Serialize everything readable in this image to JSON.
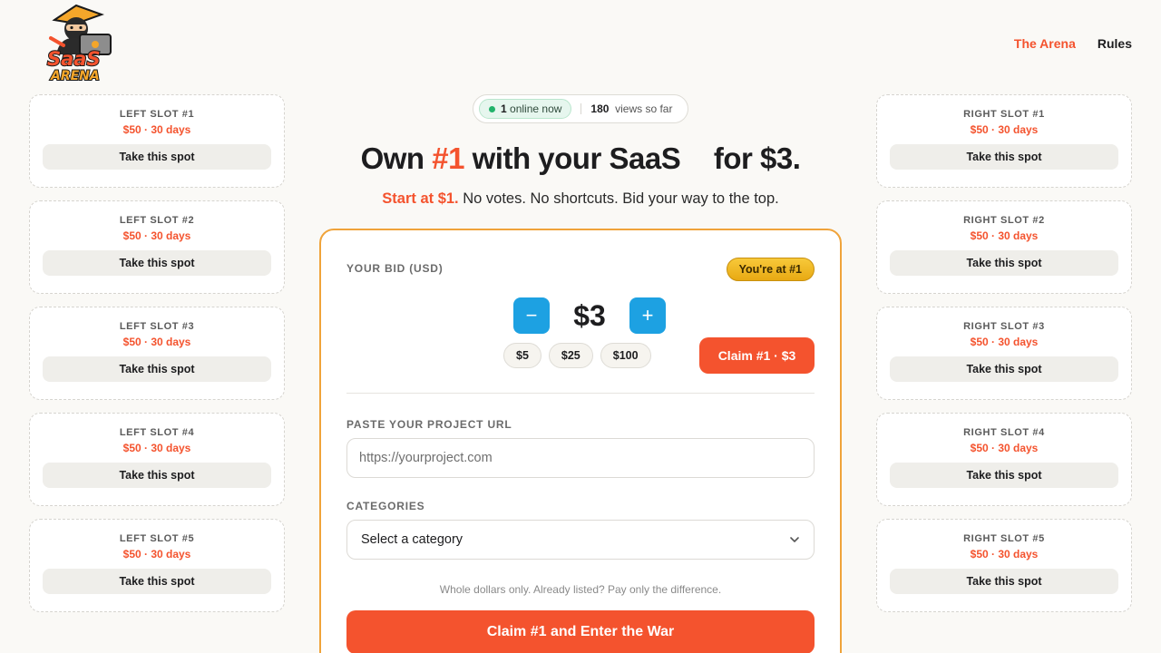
{
  "brand": {
    "logo_text_top": "SaaS",
    "logo_text_bottom": "ARENA"
  },
  "nav": {
    "items": [
      {
        "label": "The Arena",
        "active": true
      },
      {
        "label": "Rules",
        "active": false
      }
    ]
  },
  "left_slots": [
    {
      "title": "LEFT SLOT #1",
      "price": "$50 · 30 days",
      "button": "Take this spot"
    },
    {
      "title": "LEFT SLOT #2",
      "price": "$50 · 30 days",
      "button": "Take this spot"
    },
    {
      "title": "LEFT SLOT #3",
      "price": "$50 · 30 days",
      "button": "Take this spot"
    },
    {
      "title": "LEFT SLOT #4",
      "price": "$50 · 30 days",
      "button": "Take this spot"
    },
    {
      "title": "LEFT SLOT #5",
      "price": "$50 · 30 days",
      "button": "Take this spot"
    }
  ],
  "right_slots": [
    {
      "title": "RIGHT SLOT #1",
      "price": "$50 · 30 days",
      "button": "Take this spot"
    },
    {
      "title": "RIGHT SLOT #2",
      "price": "$50 · 30 days",
      "button": "Take this spot"
    },
    {
      "title": "RIGHT SLOT #3",
      "price": "$50 · 30 days",
      "button": "Take this spot"
    },
    {
      "title": "RIGHT SLOT #4",
      "price": "$50 · 30 days",
      "button": "Take this spot"
    },
    {
      "title": "RIGHT SLOT #5",
      "price": "$50 · 30 days",
      "button": "Take this spot"
    }
  ],
  "presence": {
    "online_count": "1",
    "online_label": "online now",
    "views_count": "180",
    "views_label": "views so far"
  },
  "hero": {
    "prefix": "Own",
    "highlight": "#1",
    "middle": "with your SaaS",
    "suffix": "for $3.",
    "sub_accent": "Start at $1.",
    "sub_rest": "No votes. No shortcuts. Bid your way to the top."
  },
  "bid": {
    "label": "YOUR BID (USD)",
    "badge": "You're at #1",
    "minus": "−",
    "plus": "+",
    "amount": "$3",
    "quick_amounts": [
      "$5",
      "$25",
      "$100"
    ],
    "claim_small": "Claim #1 · $3"
  },
  "form": {
    "url_label": "PASTE YOUR PROJECT URL",
    "url_placeholder": "https://yourproject.com",
    "url_value": "",
    "categories_label": "CATEGORIES",
    "category_selected": "Select a category",
    "hint": "Whole dollars only. Already listed? Pay only the difference.",
    "submit": "Claim #1 and Enter the War"
  },
  "colors": {
    "accent": "#f4532e",
    "blue": "#1da1e2",
    "gold": "#f2b824",
    "card_border": "#f0a33a",
    "online_green": "#22b36b"
  }
}
